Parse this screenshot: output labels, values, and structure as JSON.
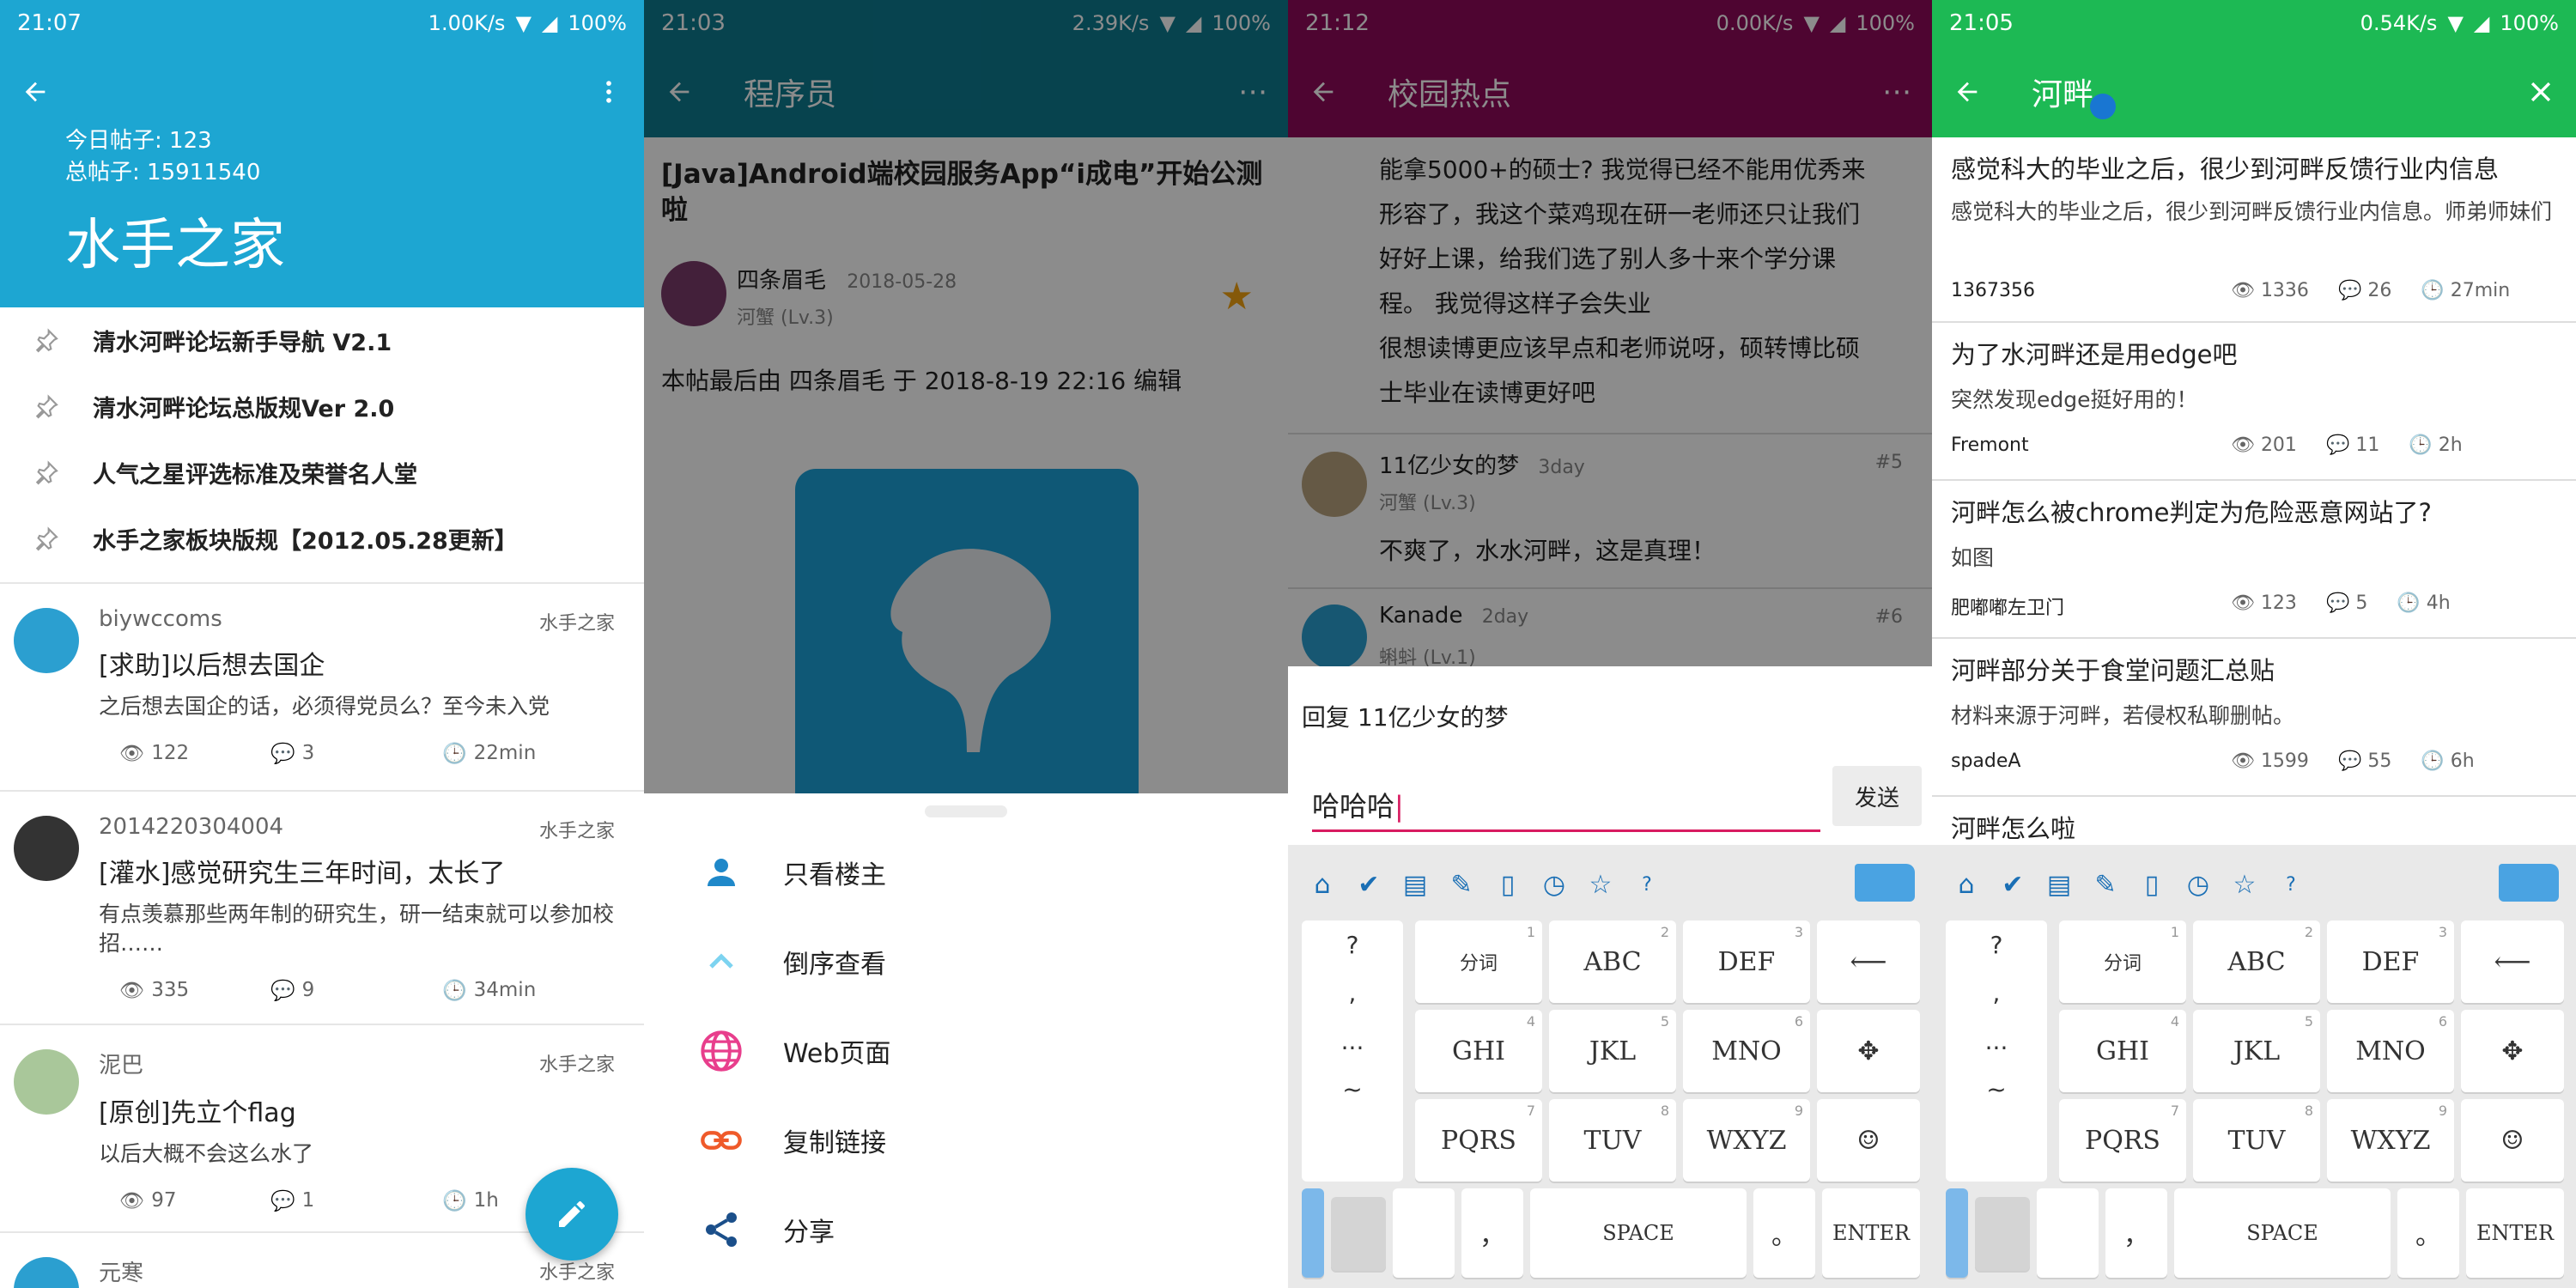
{
  "screen1": {
    "status": {
      "time": "21:07",
      "speed": "1.00K/s",
      "battery": "100%"
    },
    "header": {
      "today_posts": "今日帖子: 123",
      "total_posts": "总帖子: 15911540",
      "forum_name": "水手之家"
    },
    "pinned": [
      {
        "label": "清水河畔论坛新手导航 V2.1"
      },
      {
        "label": "清水河畔论坛总版规Ver 2.0"
      },
      {
        "label": "人气之星评选标准及荣誉名人堂"
      },
      {
        "label": "水手之家板块版规【2012.05.28更新】"
      }
    ],
    "posts": [
      {
        "user": "biywccoms",
        "board": "水手之家",
        "title": "[求助]以后想去国企",
        "excerpt": "之后想去国企的话，必须得党员么？至今未入党",
        "views": "122",
        "replies": "3",
        "time": "22min"
      },
      {
        "user": "2014220304004",
        "board": "水手之家",
        "title": "[灌水]感觉研究生三年时间，太长了",
        "excerpt": "有点羡慕那些两年制的研究生，研一结束就可以参加校招……",
        "views": "335",
        "replies": "9",
        "time": "34min"
      },
      {
        "user": "泥巴",
        "board": "水手之家",
        "title": "[原创]先立个flag",
        "excerpt": "以后大概不会这么水了",
        "views": "97",
        "replies": "1",
        "time": "1h"
      },
      {
        "user": "元寒",
        "board": "水手之家"
      }
    ],
    "colors": {
      "primary": "#1da6d2"
    }
  },
  "screen2": {
    "status": {
      "time": "21:03",
      "speed": "2.39K/s",
      "battery": "100%"
    },
    "toolbar": {
      "title": "程序员"
    },
    "thread": {
      "title": "[Java]Android端校园服务App“i成电”开始公测啦",
      "author": "四条眉毛",
      "date": "2018-05-28",
      "level": "河蟹 (Lv.3)",
      "edit_note": "本帖最后由 四条眉毛 于 2018-8-19 22:16 编辑"
    },
    "sheet": [
      {
        "label": "只看楼主",
        "icon": "person-icon"
      },
      {
        "label": "倒序查看",
        "icon": "chevron-up-icon"
      },
      {
        "label": "Web页面",
        "icon": "globe-icon"
      },
      {
        "label": "复制链接",
        "icon": "link-icon"
      },
      {
        "label": "分享",
        "icon": "share-icon"
      }
    ],
    "colors": {
      "primary": "#0d7a8f"
    }
  },
  "screen3": {
    "status": {
      "time": "21:12",
      "speed": "0.00K/s",
      "battery": "100%"
    },
    "toolbar": {
      "title": "校园热点"
    },
    "body_lines": [
      "能拿5000+的硕士? 我觉得已经不能用优秀来",
      "形容了，我这个菜鸡现在研一老师还只让我们",
      "好好上课，给我们选了别人多十来个学分课",
      "程。 我觉得这样子会失业",
      "很想读博更应该早点和老师说呀，硕转博比硕",
      "士毕业在读博更好吧"
    ],
    "replies": [
      {
        "user": "11亿少女的梦",
        "time": "3day",
        "floor": "#5",
        "level": "河蟹 (Lv.3)",
        "text": "不爽了，水水河畔，这是真理！"
      },
      {
        "user": "Kanade",
        "time": "2day",
        "floor": "#6",
        "level": "蝌蚪 (Lv.1)"
      }
    ],
    "reply_box": {
      "reply_to": "回复  11亿少女的梦",
      "input": "哈哈哈",
      "send": "发送"
    },
    "colors": {
      "primary": "#8e0a5a"
    }
  },
  "screen4": {
    "status": {
      "time": "21:05",
      "speed": "0.54K/s",
      "battery": "100%"
    },
    "toolbar": {
      "search": "河畔"
    },
    "results": [
      {
        "title": "感觉科大的毕业之后，很少到河畔反馈行业内信息",
        "excerpt": "感觉科大的毕业之后，很少到河畔反馈行业内信息。师弟师妹们",
        "user": "1367356",
        "views": "1336",
        "replies": "26",
        "time": "27min"
      },
      {
        "title": "为了水河畔还是用edge吧",
        "excerpt": "突然发现edge挺好用的！",
        "user": "Fremont",
        "views": "201",
        "replies": "11",
        "time": "2h"
      },
      {
        "title": "河畔怎么被chrome判定为危险恶意网站了?",
        "excerpt": "如图",
        "user": "肥嘟嘟左卫门",
        "views": "123",
        "replies": "5",
        "time": "4h"
      },
      {
        "title": "河畔部分关于食堂问题汇总贴",
        "excerpt": "材料来源于河畔，若侵权私聊删帖。",
        "user": "spadeA",
        "views": "1599",
        "replies": "55",
        "time": "6h"
      },
      {
        "title": "河畔怎么啦"
      }
    ],
    "colors": {
      "primary": "#1db954"
    }
  },
  "keyboard": {
    "symbols": [
      "?",
      ",",
      "...",
      "~"
    ],
    "rows": [
      [
        {
          "label": "分词",
          "num": "1"
        },
        {
          "label": "ABC",
          "num": "2"
        },
        {
          "label": "DEF",
          "num": "3"
        }
      ],
      [
        {
          "label": "GHI",
          "num": "4"
        },
        {
          "label": "JKL",
          "num": "5"
        },
        {
          "label": "MNO",
          "num": "6"
        }
      ],
      [
        {
          "label": "PQRS",
          "num": "7"
        },
        {
          "label": "TUV",
          "num": "8"
        },
        {
          "label": "WXYZ",
          "num": "9"
        }
      ]
    ],
    "bottom": {
      "comma": "，",
      "space": "SPACE",
      "period": "。",
      "enter": "ENTER"
    }
  }
}
